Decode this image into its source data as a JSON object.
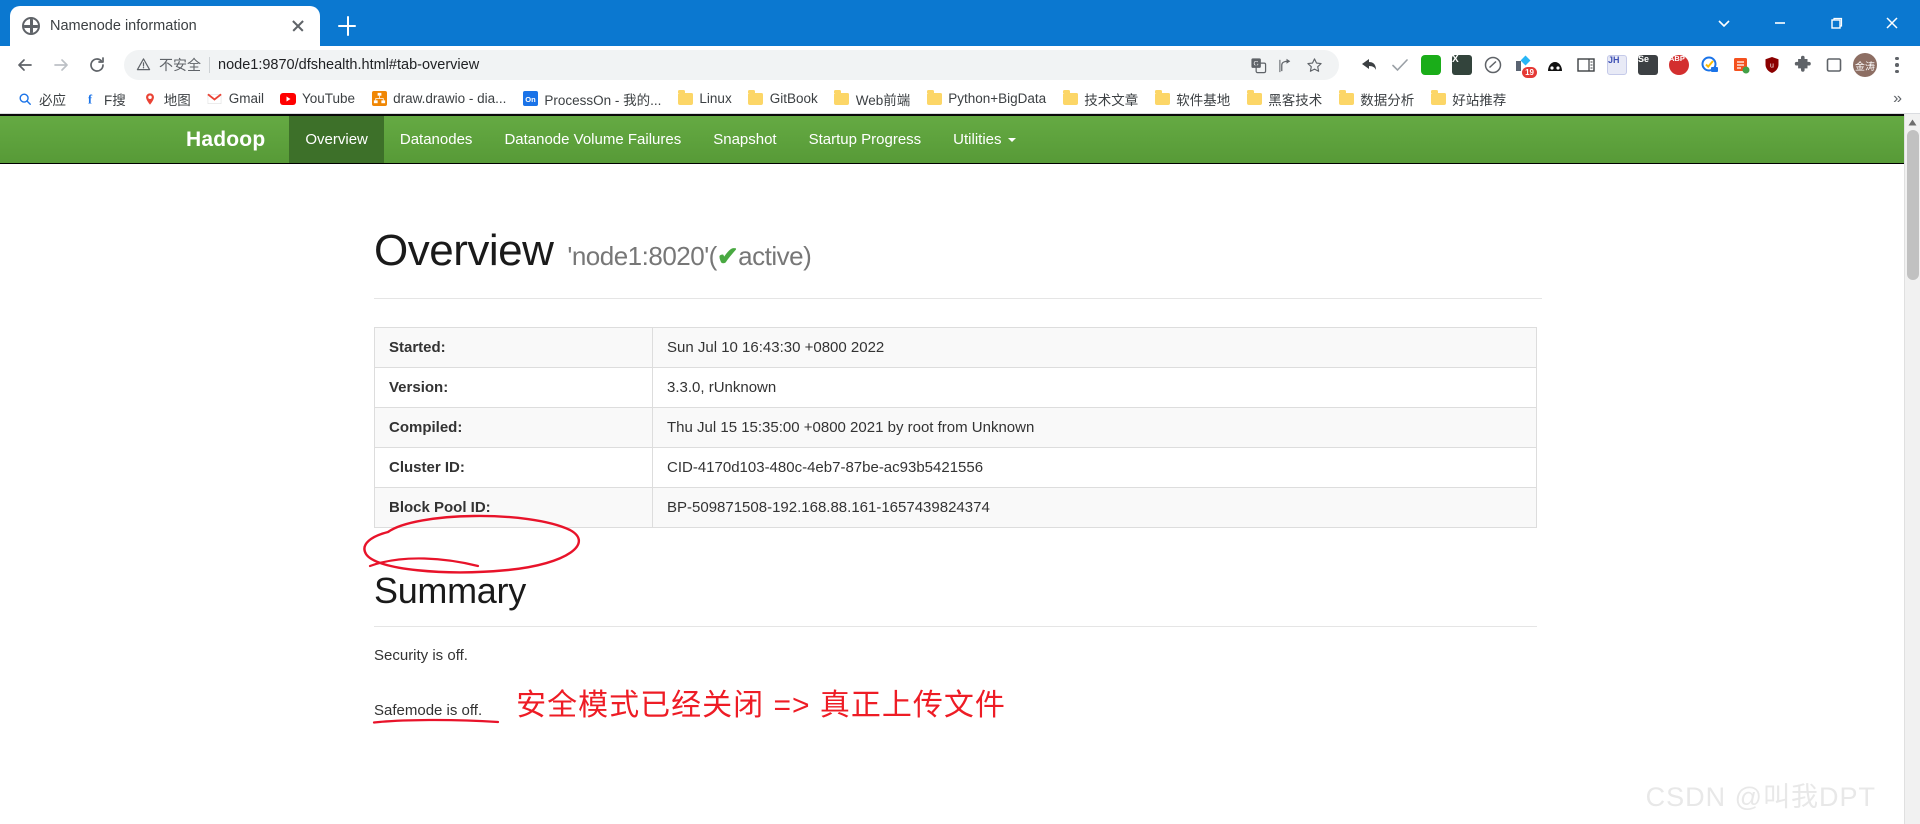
{
  "window": {
    "minimize_label": "Minimize",
    "maximize_label": "Restore",
    "close_label": "Close",
    "dropdown_label": "Tab search"
  },
  "tab": {
    "title": "Namenode information",
    "favicon": "globe-icon",
    "close_label": "Close tab",
    "new_tab_label": "New tab"
  },
  "toolbar": {
    "back_label": "Back",
    "forward_label": "Forward",
    "reload_label": "Reload",
    "security_text": "不安全",
    "url": "node1:9870/dfshealth.html#tab-overview",
    "translate_label": "Translate this page",
    "share_label": "Share this page",
    "bookmark_label": "Bookmark this tab",
    "menu_label": "Customize and control Google Chrome",
    "profile_initials": "金涛",
    "extensions": [
      {
        "name": "back-arrow-extension",
        "glyph": "↰",
        "color": "#3c4043",
        "type": "glyph"
      },
      {
        "name": "checkmark-extension",
        "glyph": "✓",
        "color": "#9aa0a6",
        "type": "glyph"
      },
      {
        "name": "wechat-extension",
        "glyph": "",
        "color": "#1aad19",
        "type": "square",
        "label": ""
      },
      {
        "name": "excel-extension",
        "glyph": "X",
        "color": "#33443c",
        "type": "square",
        "label": "X"
      },
      {
        "name": "circle-arrow-extension",
        "glyph": "◎",
        "color": "#5f6368",
        "type": "glyph"
      },
      {
        "name": "ruanmei-extension",
        "glyph": "",
        "color": "#4a5568",
        "type": "custom",
        "badge": "19"
      },
      {
        "name": "dark-avatar-extension",
        "glyph": "",
        "color": "#111111",
        "type": "custom"
      },
      {
        "name": "reading-panel-extension",
        "glyph": "",
        "color": "#3c4043",
        "type": "custom"
      },
      {
        "name": "jh-extension",
        "glyph": "JH",
        "color": "#5c6bc0",
        "type": "square",
        "label": "JH"
      },
      {
        "name": "selenium-extension",
        "glyph": "Se",
        "color": "#3c4043",
        "type": "square",
        "label": "Se"
      },
      {
        "name": "adblock-plus-extension",
        "glyph": "ABP",
        "color": "#d32f2f",
        "type": "round",
        "label": "ABP"
      },
      {
        "name": "task-check-extension",
        "glyph": "",
        "color": "#1a73e8",
        "type": "custom"
      },
      {
        "name": "notes-extension",
        "glyph": "",
        "color": "#f4511e",
        "type": "custom"
      },
      {
        "name": "ublock-origin-extension",
        "glyph": "u",
        "color": "#8b0000",
        "type": "shield",
        "label": "u"
      },
      {
        "name": "extensions-puzzle-icon",
        "glyph": "",
        "color": "#5f6368",
        "type": "puzzle"
      },
      {
        "name": "side-panel-icon",
        "glyph": "",
        "color": "#5f6368",
        "type": "panel"
      }
    ]
  },
  "bookmarks": {
    "items": [
      {
        "label": "必应",
        "icon": "search-icon"
      },
      {
        "label": "F搜",
        "icon": "f-icon"
      },
      {
        "label": "地图",
        "icon": "map-pin-icon"
      },
      {
        "label": "Gmail",
        "icon": "gmail-icon"
      },
      {
        "label": "YouTube",
        "icon": "youtube-icon"
      },
      {
        "label": "draw.drawio - dia...",
        "icon": "drawio-icon"
      },
      {
        "label": "ProcessOn - 我的...",
        "icon": "processon-icon"
      },
      {
        "label": "Linux",
        "icon": "folder-icon"
      },
      {
        "label": "GitBook",
        "icon": "folder-icon"
      },
      {
        "label": "Web前端",
        "icon": "folder-icon"
      },
      {
        "label": "Python+BigData",
        "icon": "folder-icon"
      },
      {
        "label": "技术文章",
        "icon": "folder-icon"
      },
      {
        "label": "软件基地",
        "icon": "folder-icon"
      },
      {
        "label": "黑客技术",
        "icon": "folder-icon"
      },
      {
        "label": "数据分析",
        "icon": "folder-icon"
      },
      {
        "label": "好站推荐",
        "icon": "folder-icon"
      }
    ],
    "overflow_label": "»"
  },
  "hadoop": {
    "brand": "Hadoop",
    "nav": [
      {
        "label": "Overview",
        "active": true
      },
      {
        "label": "Datanodes",
        "active": false
      },
      {
        "label": "Datanode Volume Failures",
        "active": false
      },
      {
        "label": "Snapshot",
        "active": false
      },
      {
        "label": "Startup Progress",
        "active": false
      },
      {
        "label": "Utilities",
        "active": false,
        "dropdown": true
      }
    ],
    "nav_bg": "#5aa03c",
    "nav_active_bg": "#3d7029"
  },
  "overview": {
    "title": "Overview",
    "address": "'node1:8020'",
    "status_open": "(",
    "status_check": "✔",
    "status_text": "active",
    "status_close": ")",
    "table": [
      {
        "key": "Started:",
        "value": "Sun Jul 10 16:43:30 +0800 2022"
      },
      {
        "key": "Version:",
        "value": "3.3.0, rUnknown"
      },
      {
        "key": "Compiled:",
        "value": "Thu Jul 15 15:35:00 +0800 2021 by root from Unknown"
      },
      {
        "key": "Cluster ID:",
        "value": "CID-4170d103-480c-4eb7-87be-ac93b5421556"
      },
      {
        "key": "Block Pool ID:",
        "value": "BP-509871508-192.168.88.161-1657439824374"
      }
    ]
  },
  "summary": {
    "title": "Summary",
    "security_line": "Security is off.",
    "safemode_line": "Safemode is off.",
    "annotation": "安全模式已经关闭 => 真正上传文件",
    "annotation_color": "#ee1c25"
  },
  "watermark": {
    "text": "CSDN @叫我DPT"
  }
}
